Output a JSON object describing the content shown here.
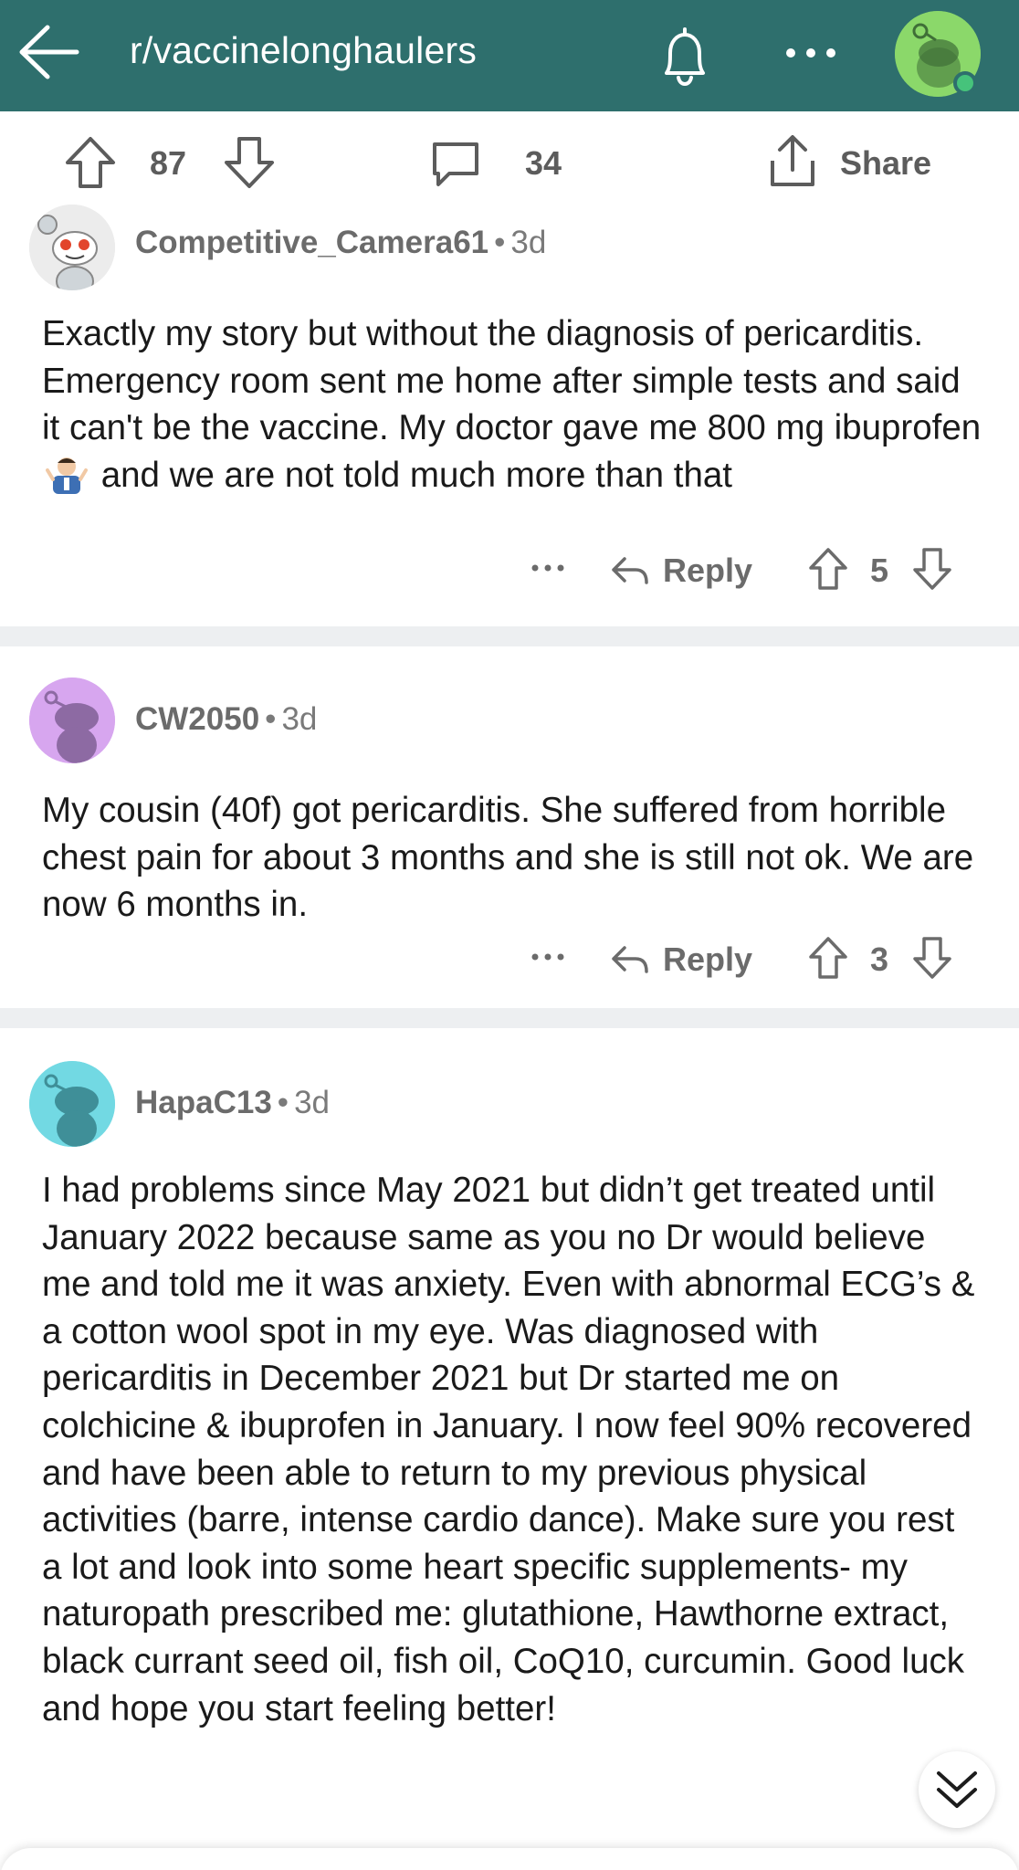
{
  "header": {
    "subreddit": "r/vaccinelonghaulers",
    "icons": [
      "back-arrow-icon",
      "bell-icon",
      "more-icon",
      "avatar"
    ],
    "bg_color": "#2e6f6d"
  },
  "post_bar": {
    "score": "87",
    "comment_count": "34",
    "share_label": "Share"
  },
  "comments": [
    {
      "username": "Competitive_Camera61",
      "separator": "•",
      "age": "3d",
      "body_before_emoji": "Exactly my story but without the diagnosis of pericarditis. Emergency room sent me home after simple tests and said it can't be the vaccine. My doctor gave me 800 mg ibuprofen",
      "emoji": "man-shrugging-emoji",
      "body_after_emoji": "and we are not told much more than that",
      "reply_label": "Reply",
      "score": "5",
      "avatar_color": "#e6e6e6"
    },
    {
      "username": "CW2050",
      "separator": "•",
      "age": "3d",
      "body": "My cousin (40f) got pericarditis. She suffered from horrible chest pain for about 3 months and she is still not ok. We are now 6 months in.",
      "reply_label": "Reply",
      "score": "3",
      "avatar_color": "#d7a6ef"
    },
    {
      "username": "HapaC13",
      "separator": "•",
      "age": "3d",
      "body": "I had problems since May 2021 but didn’t get treated until January 2022 because same as you no Dr would believe me and told me it was anxiety. Even with abnormal ECG’s & a cotton wool spot in my eye. Was diagnosed with pericarditis in December 2021 but Dr started me on colchicine & ibuprofen in January. I now feel 90% recovered and have been able to return to my previous physical activities (barre, intense cardio dance). Make sure you rest a lot and look into some heart specific supplements- my naturopath prescribed me: glutathione, Hawthorne extract, black currant seed oil, fish oil, CoQ10, curcumin. Good luck and hope you start feeling better!",
      "avatar_color": "#72d9e3"
    }
  ]
}
